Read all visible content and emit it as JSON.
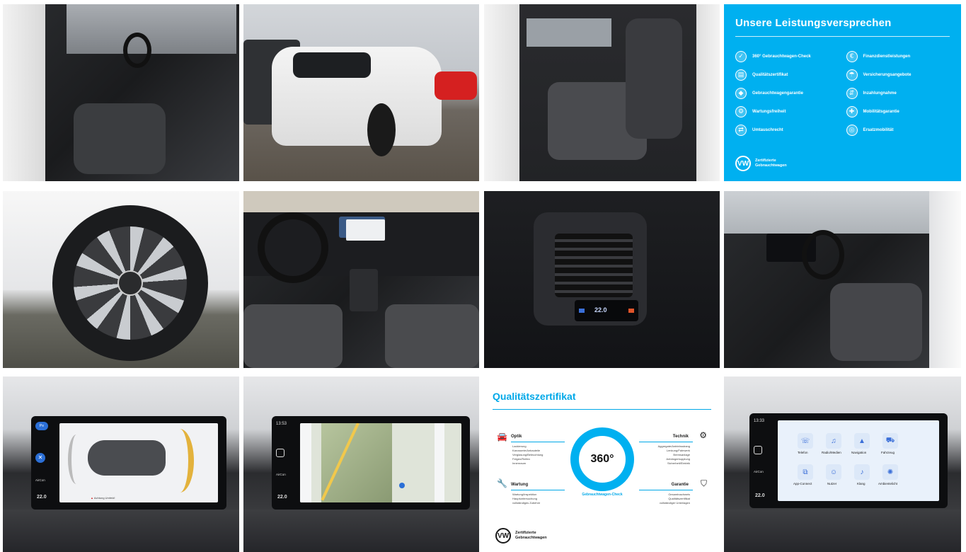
{
  "gallery": {
    "promise_panel": {
      "title": "Unsere Leistungsversprechen",
      "left_items": [
        {
          "label": "360° Gebrauchtwagen-Check",
          "icon": "car-check-icon"
        },
        {
          "label": "Qualitätszertifikat",
          "icon": "certificate-icon"
        },
        {
          "label": "Gebrauchtwagengarantie",
          "icon": "shield-icon"
        },
        {
          "label": "Wartungsfreiheit",
          "icon": "wrench-icon"
        },
        {
          "label": "Umtauschrecht",
          "icon": "exchange-icon"
        }
      ],
      "right_items": [
        {
          "label": "Finanzdienstleistungen",
          "icon": "finance-icon"
        },
        {
          "label": "Versicherungsangebote",
          "icon": "insurance-icon"
        },
        {
          "label": "Inzahlungnahme",
          "icon": "trade-in-icon"
        },
        {
          "label": "Mobilitätsgarantie",
          "icon": "mobility-icon"
        },
        {
          "label": "Ersatzmobilität",
          "icon": "replacement-car-icon"
        }
      ],
      "brand_line1": "Zertifizierte",
      "brand_line2": "Gebrauchtwagen",
      "logo": "VW"
    },
    "quality_panel": {
      "title": "Qualitätszertifikat",
      "center": "360°",
      "ring_text": "Gebrauchtwagen-Check",
      "sections": {
        "optik": "Optik",
        "technik": "Technik",
        "wartung": "Wartung",
        "garantie": "Garantie"
      },
      "optik_list": [
        "Lackierung",
        "Karosserie/Anbauteile",
        "Verglasung/Beleuchtung",
        "Felgen/Reifen",
        "Innenraum"
      ],
      "technik_list": [
        "Aggregate/Antriebsstrang",
        "Lenkung/Fahrwerk",
        "Bremsanlage",
        "Anhängerkupplung",
        "Sicherheit/Elektrik"
      ],
      "wartung_list": [
        "Wartung/Inspektion",
        "Hauptuntersuchung",
        "vollständiges Zubehör"
      ],
      "garantie_list": [
        "Gesamtnachweis",
        "Qualitätszertifikat",
        "vollständiger Unterlagen"
      ],
      "brand_line1": "Zertifizierte",
      "brand_line2": "Gebrauchtwagen",
      "logo": "VW"
    },
    "screen_park": {
      "btn": "P≡",
      "label": "AirCon",
      "temp": "22.0",
      "warning": "Achtung Umfeld!"
    },
    "screen_nav": {
      "clock": "13:53",
      "label": "AirCon",
      "temp": "22.0"
    },
    "screen_apps": {
      "clock": "13:33",
      "label": "AirCon",
      "temp": "22.0",
      "apps": [
        "Telefon",
        "Radio/Medien",
        "Navigation",
        "Fahrzeug",
        "App-Connect",
        "Nutzer",
        "Klang",
        "Ambientelicht"
      ]
    },
    "rear_climate": {
      "temp": "22.0"
    },
    "colors": {
      "vw_blue": "#00b0f0",
      "certificate_blue": "#00a8e8"
    }
  }
}
